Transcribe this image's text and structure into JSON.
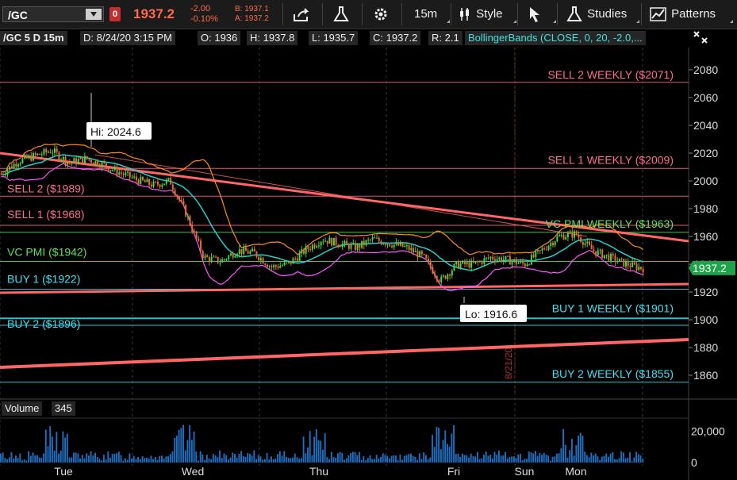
{
  "toolbar": {
    "symbol": "/GC",
    "flag": "0",
    "last": "1937.2",
    "change": "-2.00",
    "change_pct": "-0.10%",
    "bid": "B: 1937.1",
    "ask": "A: 1937.2",
    "timeframe": "15m",
    "style_label": "Style",
    "studies_label": "Studies",
    "patterns_label": "Patterns"
  },
  "info_bar": {
    "chart_id": "/GC 5 D 15m",
    "date": "D: 8/24/20 3:15 PM",
    "open": "O: 1936",
    "high": "H: 1937.8",
    "low": "L: 1935.7",
    "close": "C: 1937.2",
    "range": "R: 2.1",
    "study": "BollingerBands (CLOSE, 0, 20, -2.0,..."
  },
  "price_axis": {
    "ticks": [
      "2080",
      "2060",
      "2040",
      "2020",
      "2000",
      "1980",
      "1960",
      "1940",
      "1920",
      "1900",
      "1880",
      "1860"
    ],
    "current": "1937.2"
  },
  "volume_axis": {
    "ticks": [
      "20,000",
      "0"
    ]
  },
  "time_axis": {
    "labels": [
      "Tue",
      "Wed",
      "Thu",
      "Fri",
      "Sun",
      "Mon"
    ]
  },
  "volume_pane": {
    "label": "Volume",
    "value": "345"
  },
  "levels": {
    "sell2_weekly": "SELL 2 WEEKLY ($2071)",
    "sell1_weekly": "SELL 1 WEEKLY ($2009)",
    "sell2": "SELL 2 ($1989)",
    "sell1": "SELL 1 ($1968)",
    "vc_pmi_weekly": "VC PMI WEEKLY ($1963)",
    "vc_pmi": "VC PMI  ($1942)",
    "buy1": "BUY 1 ($1922)",
    "buy1_weekly": "BUY 1 WEEKLY ($1901)",
    "buy2": "BUY 2 ($1896)",
    "buy2_weekly": "BUY 2 WEEKLY ($1855)"
  },
  "callouts": {
    "hi": "Hi: 2024.6",
    "lo": "Lo: 1916.6",
    "date_marker": "8/21/20"
  },
  "colors": {
    "sell": "#ff6b8a",
    "buy": "#3ee0f0",
    "pmi": "#5ee05e",
    "trend": "#ff6666",
    "bollinger_upper": "#ff8c1a",
    "bollinger_lower": "#ff55ff",
    "midline": "#22d0d0",
    "volume": "#1f6fc0"
  },
  "chart_data": {
    "type": "line",
    "title": "",
    "x": [
      "Tue",
      "Wed",
      "Thu",
      "Fri",
      "Sun",
      "Mon"
    ],
    "ylim": [
      1850,
      2093
    ],
    "series": [
      {
        "values": [
          2005,
          2014,
          2018,
          2022,
          2013,
          2016,
          2012,
          2006,
          2001,
          1997,
          2000,
          1975,
          1945,
          1942,
          1950,
          1948,
          1938,
          1940,
          1950,
          1958,
          1955,
          1952,
          1958,
          1955,
          1952,
          1945,
          1928,
          1940,
          1940,
          1945,
          1943,
          1940,
          1950,
          1960,
          1962,
          1950,
          1945,
          1940,
          1937
        ]
      }
    ],
    "levels": [
      2071,
      2009,
      1989,
      1968,
      1963,
      1942,
      1922,
      1901,
      1896,
      1855
    ],
    "hi": 2024.6,
    "lo": 1916.6
  }
}
